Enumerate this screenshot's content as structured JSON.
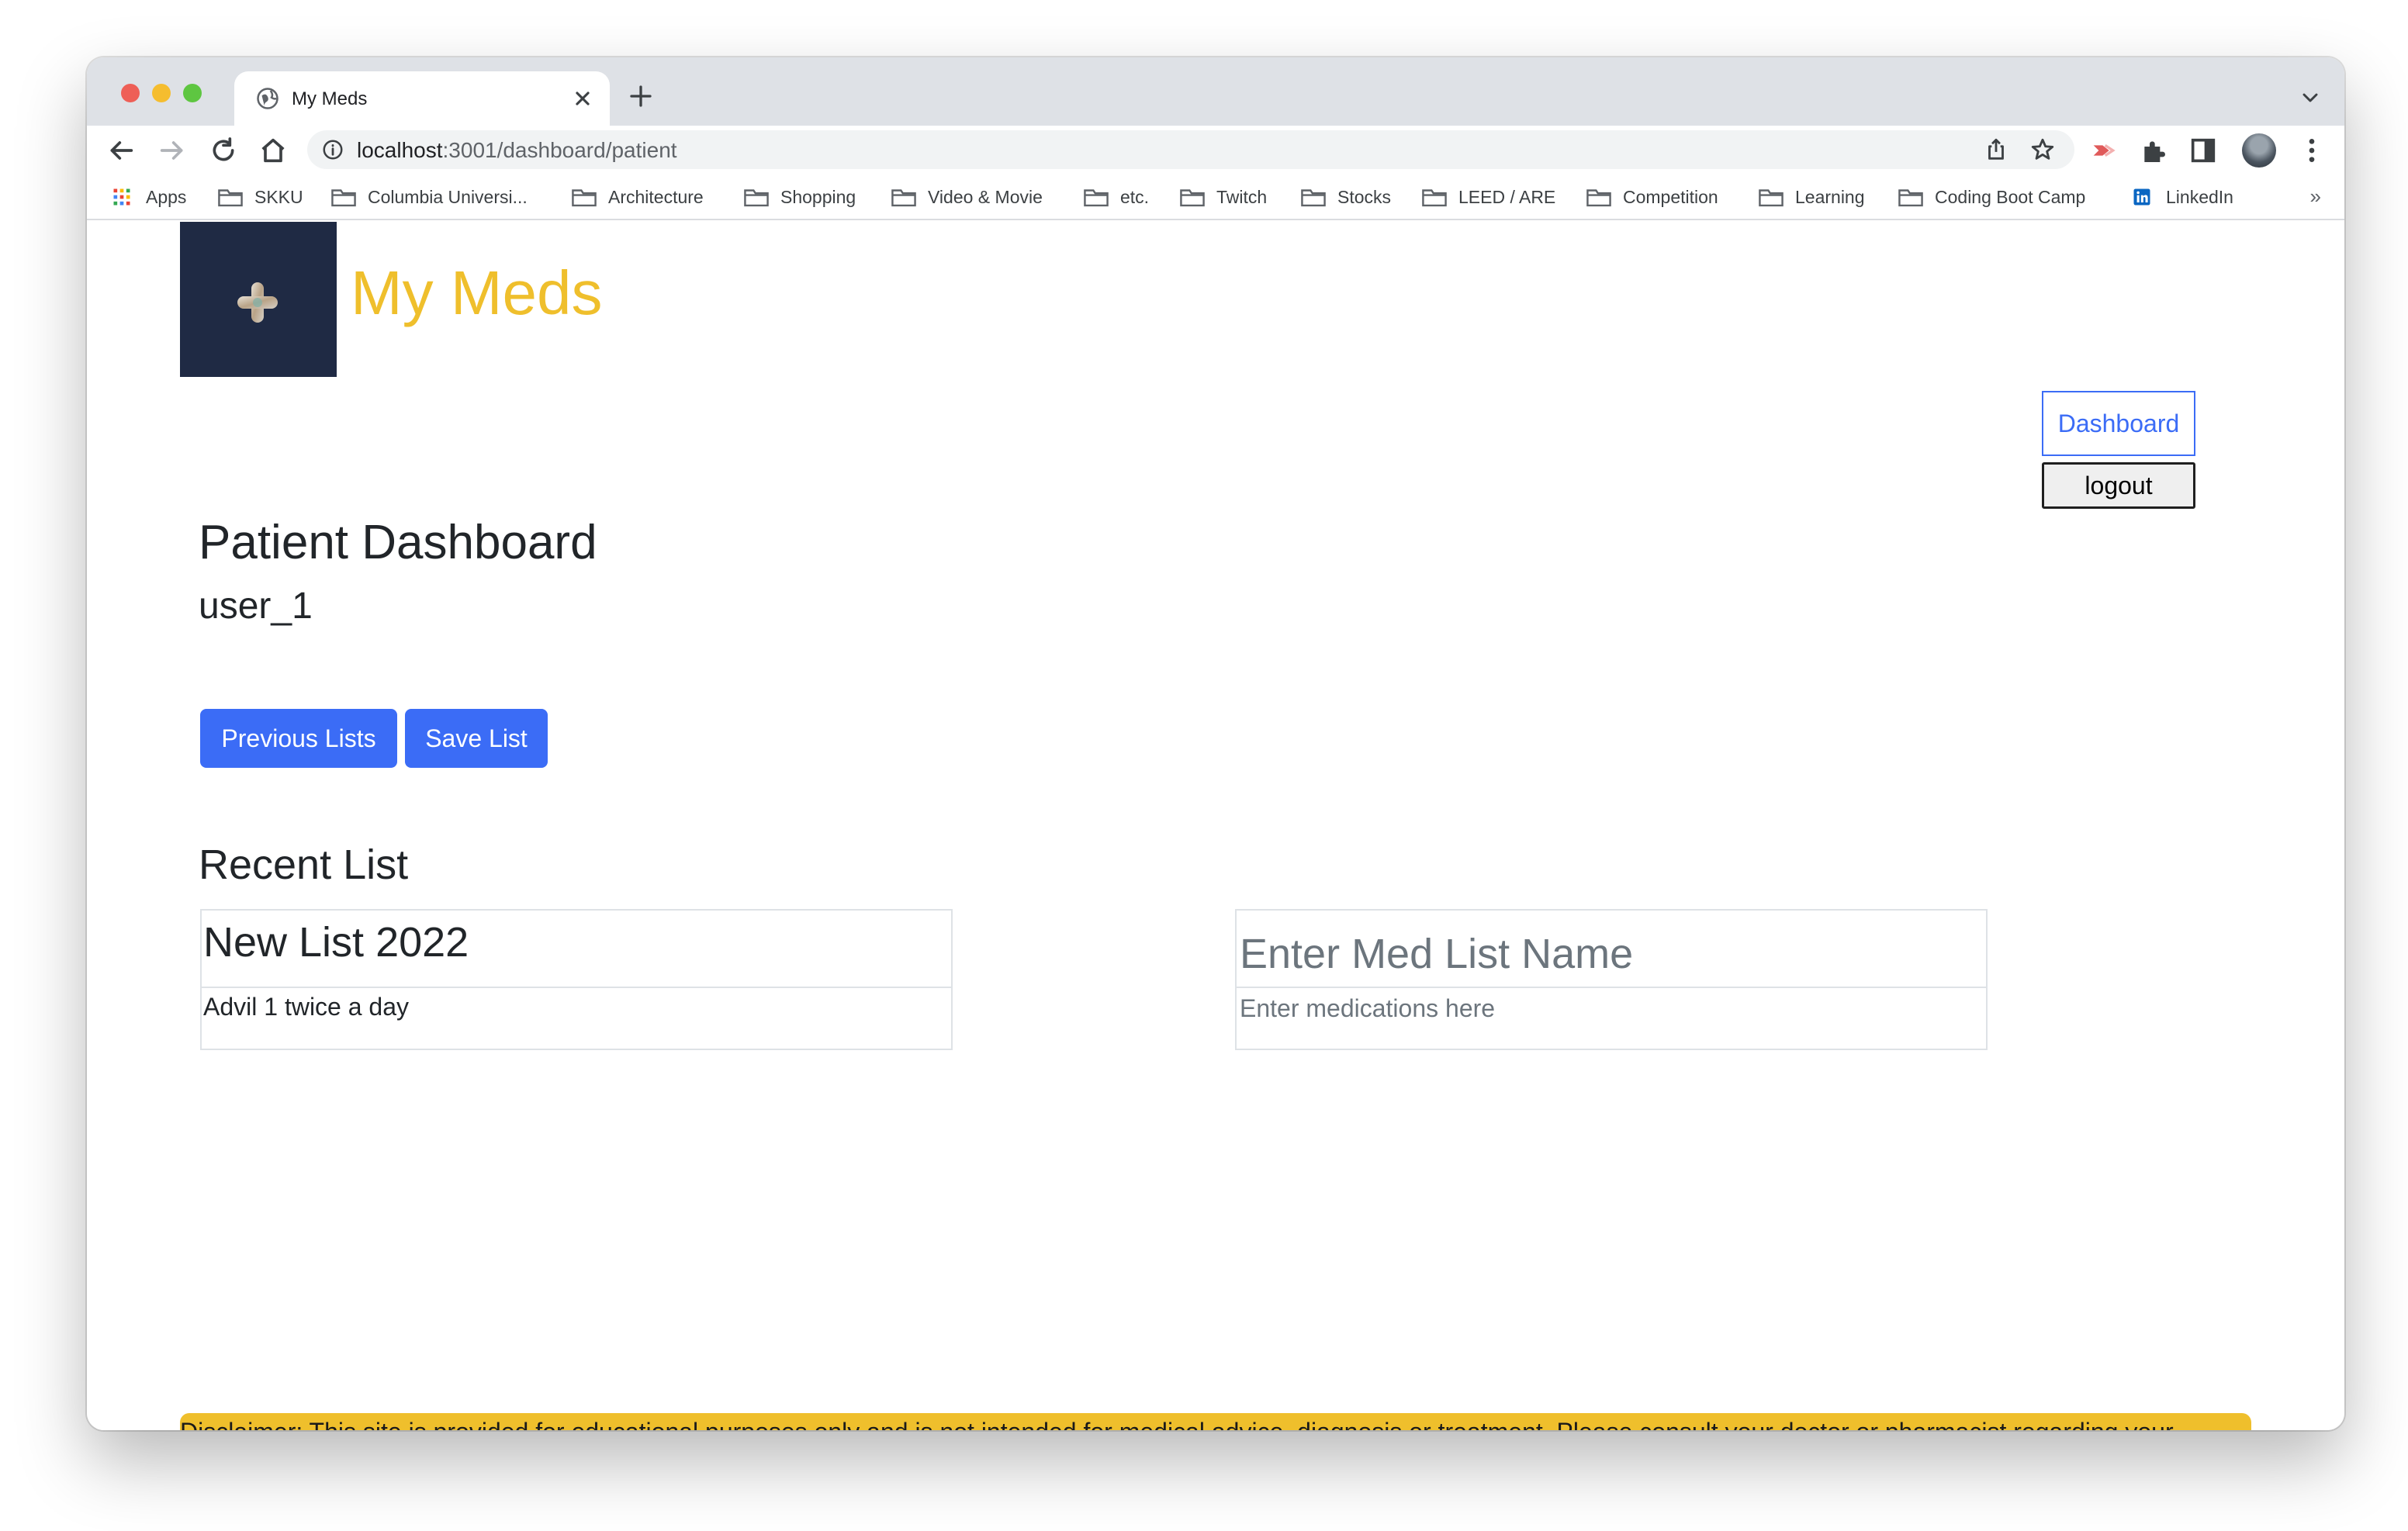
{
  "browser": {
    "tab_title": "My Meds",
    "url_host": "localhost",
    "url_path": ":3001/dashboard/patient",
    "bookmarks": [
      "Apps",
      "SKKU",
      "Columbia Universi...",
      "Architecture",
      "Shopping",
      "Video & Movie",
      "etc.",
      "Twitch",
      "Stocks",
      "LEED / ARE",
      "Competition",
      "Learning",
      "Coding Boot Camp",
      "LinkedIn"
    ],
    "bookmarks_overflow": "»"
  },
  "header": {
    "app_title": "My Meds",
    "nav_dashboard": "Dashboard",
    "logout": "logout"
  },
  "main": {
    "heading": "Patient Dashboard",
    "username": "user_1",
    "previous_lists_button": "Previous Lists",
    "save_list_button": "Save List",
    "recent_heading": "Recent List",
    "recent_list": {
      "name": "New List 2022",
      "medications": "Advil 1 twice a day"
    },
    "new_list_form": {
      "name_placeholder": "Enter Med List Name",
      "meds_placeholder": "Enter medications here"
    }
  },
  "footer": {
    "disclaimer": "Disclaimer: This site is provided for educational purposes only and is not intended for medical advice, diagnosis or treatment. Please consult your doctor or pharmacist regarding your medications."
  },
  "colors": {
    "brand_yellow": "#efbf2c",
    "primary_blue": "#3b6cf6",
    "logo_navy": "#1f2a44"
  }
}
